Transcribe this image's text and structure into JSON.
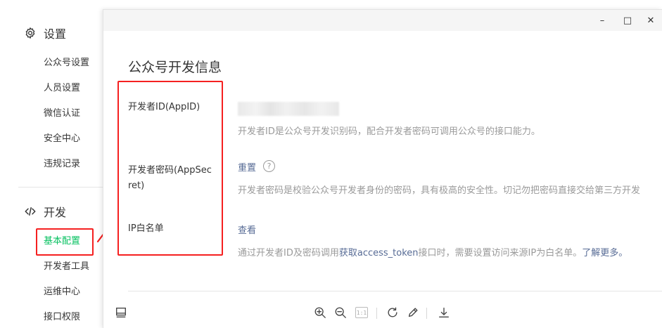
{
  "sidebar": {
    "settings_title": "设置",
    "settings_items": [
      "公众号设置",
      "人员设置",
      "微信认证",
      "安全中心",
      "违规记录"
    ],
    "dev_title": "开发",
    "dev_items": [
      "基本配置",
      "开发者工具",
      "运维中心",
      "接口权限"
    ],
    "active_item": "基本配置"
  },
  "window": {
    "minimize_glyph": "–",
    "maximize_glyph": "□",
    "close_glyph": "✕"
  },
  "main": {
    "page_title": "公众号开发信息",
    "app_id": {
      "label": "开发者ID(AppID)",
      "desc": "开发者ID是公众号开发识别码，配合开发者密码可调用公众号的接口能力。"
    },
    "app_secret": {
      "label_line1": "开发者密码(AppSec",
      "label_line2": "ret)",
      "action": "重置",
      "help_glyph": "?",
      "desc": "开发者密码是校验公众号开发者身份的密码，具有极高的安全性。切记勿把密码直接交给第三方开发"
    },
    "ip_whitelist": {
      "label": "IP白名单",
      "action": "查看",
      "desc_prefix": "通过开发者ID及密码调用",
      "desc_link1": "获取access_token",
      "desc_middle": "接口时，需要设置访问来源IP为白名单。",
      "desc_link2": "了解更多。"
    }
  },
  "toolbar": {
    "icons": [
      "panel-toggle-icon",
      "zoom-in-icon",
      "zoom-out-icon",
      "actual-size-icon",
      "rotate-icon",
      "edit-icon",
      "download-icon"
    ],
    "actual_size_label": "1:1"
  },
  "colors": {
    "accent_green": "#07c160",
    "link_blue": "#576b95",
    "annotation_red": "#f52020",
    "muted_text": "#9a9a9a"
  }
}
